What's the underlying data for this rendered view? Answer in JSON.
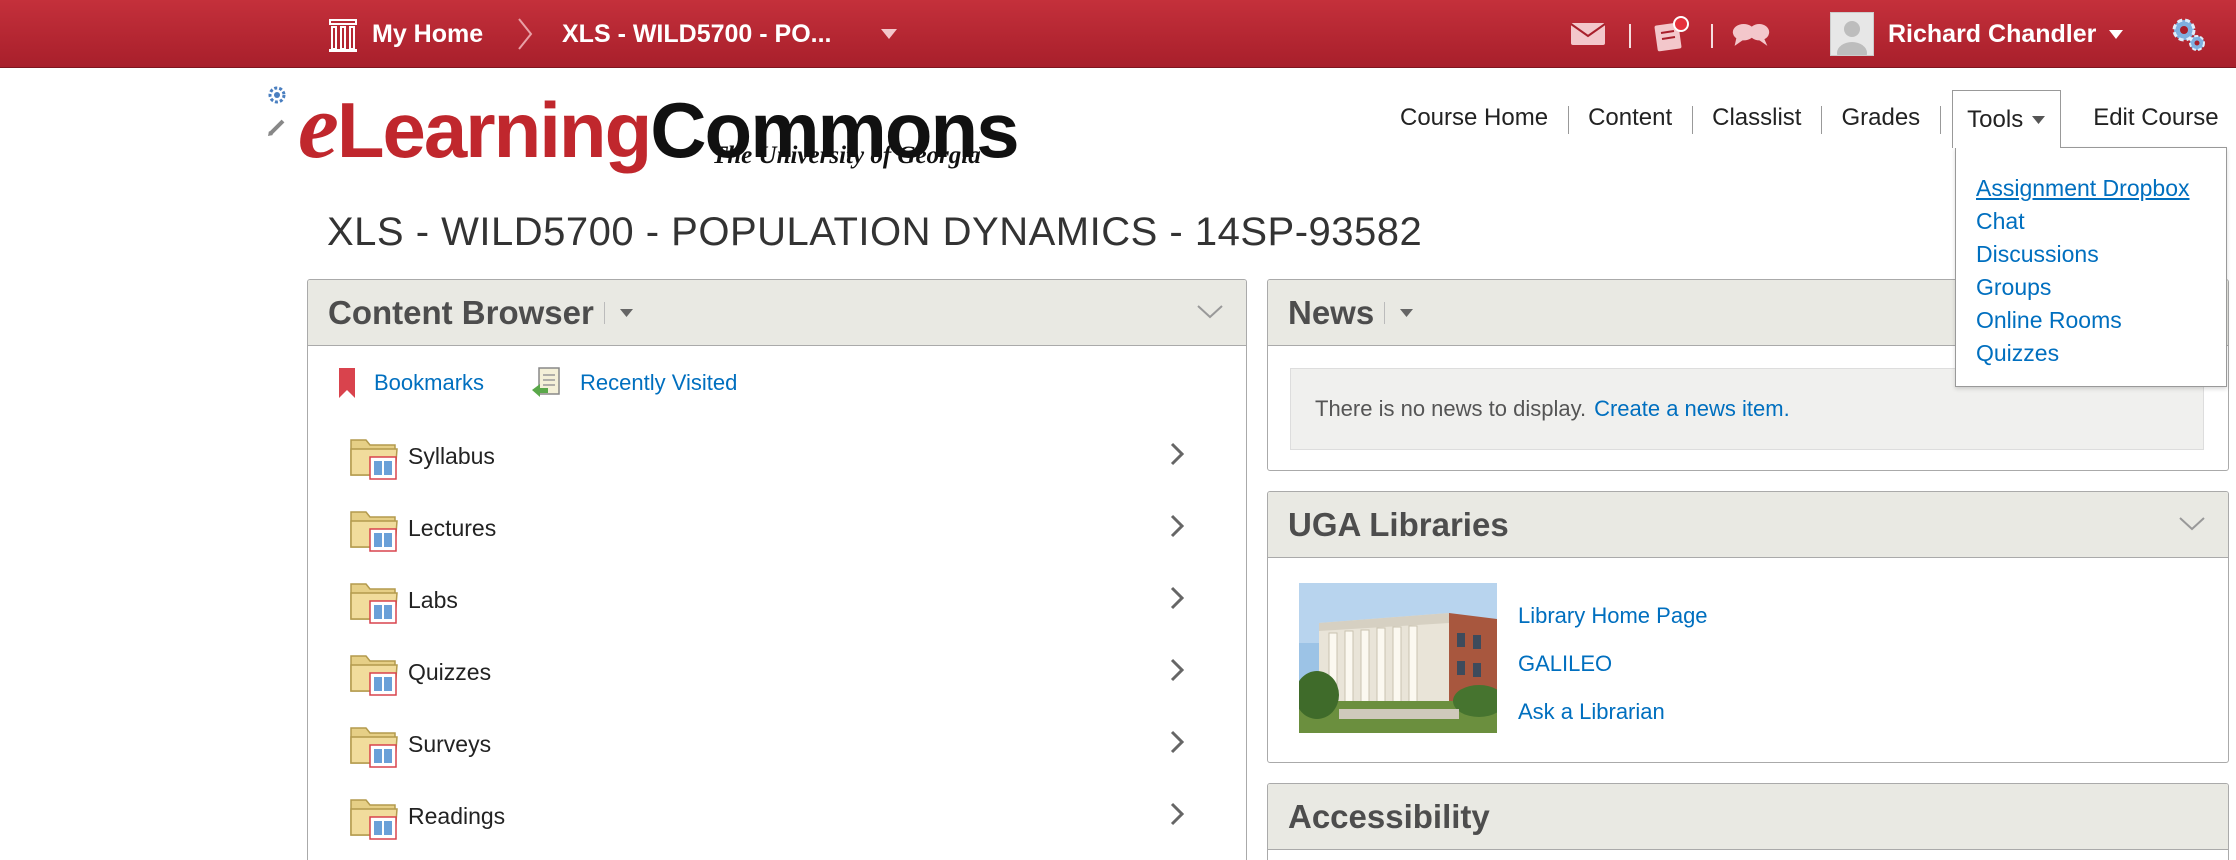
{
  "topbar": {
    "home_label": "My Home",
    "course_label": "XLS - WILD5700 - PO...",
    "user_name": "Richard Chandler",
    "icons": [
      "home-icon",
      "chevron-right-icon",
      "caret-down-icon",
      "message-icon",
      "updates-icon",
      "chat-icon",
      "avatar",
      "gear-icon"
    ]
  },
  "header": {
    "logo_e": "e",
    "logo_learning": "Learning",
    "logo_commons": "Commons",
    "logo_sub": "The University of Georgia",
    "nav": {
      "course_home": "Course Home",
      "content": "Content",
      "classlist": "Classlist",
      "grades": "Grades",
      "tools": "Tools",
      "edit_course": "Edit Course"
    },
    "tools_menu": [
      "Assignment Dropbox",
      "Chat",
      "Discussions",
      "Groups",
      "Online Rooms",
      "Quizzes"
    ]
  },
  "course_title": "XLS - WILD5700 - POPULATION DYNAMICS - 14SP-93582",
  "content_browser": {
    "title": "Content Browser",
    "bookmarks": "Bookmarks",
    "recently_visited": "Recently Visited",
    "items": [
      "Syllabus",
      "Lectures",
      "Labs",
      "Quizzes",
      "Surveys",
      "Readings"
    ]
  },
  "news": {
    "title": "News",
    "empty_text": "There is no news to display.",
    "create_link": "Create a news item."
  },
  "libraries": {
    "title": "UGA Libraries",
    "links": [
      "Library Home Page",
      "GALILEO",
      "Ask a Librarian"
    ]
  },
  "accessibility": {
    "title": "Accessibility"
  },
  "colors": {
    "topbar": "#b52632",
    "link": "#006fbf",
    "widget_header": "#e9e9e3",
    "logo_red": "#c0272d"
  }
}
